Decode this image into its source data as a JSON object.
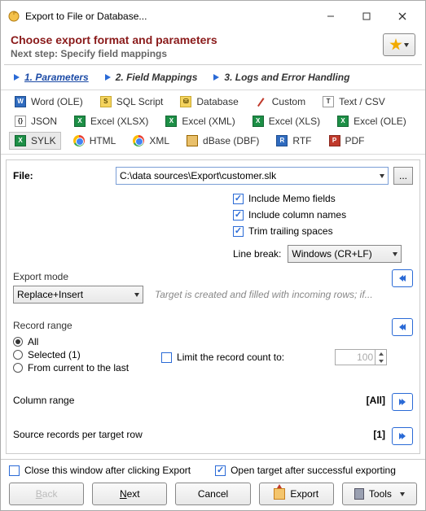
{
  "window": {
    "title": "Export to File or Database..."
  },
  "header": {
    "title": "Choose export format and parameters",
    "subtitle": "Next step: Specify field mappings"
  },
  "steps": {
    "s1": "1. Parameters",
    "s2": "2. Field Mappings",
    "s3": "3. Logs and Error Handling"
  },
  "formats": {
    "word_ole": "Word (OLE)",
    "sql_script": "SQL Script",
    "database": "Database",
    "custom": "Custom",
    "text_csv": "Text / CSV",
    "json": "JSON",
    "excel_xlsx": "Excel (XLSX)",
    "excel_xml": "Excel (XML)",
    "excel_xls": "Excel (XLS)",
    "excel_ole": "Excel (OLE)",
    "sylk": "SYLK",
    "html": "HTML",
    "xml": "XML",
    "dbase_dbf": "dBase (DBF)",
    "rtf": "RTF",
    "pdf": "PDF"
  },
  "file": {
    "label": "File:",
    "path": "C:\\data sources\\Export\\customer.slk"
  },
  "options": {
    "include_memo": "Include Memo fields",
    "include_cols": "Include column names",
    "trim_spaces": "Trim trailing spaces"
  },
  "linebreak": {
    "label": "Line break:",
    "value": "Windows (CR+LF)"
  },
  "export_mode": {
    "label": "Export mode",
    "value": "Replace+Insert",
    "hint": "Target is created and filled with incoming rows; if..."
  },
  "record_range": {
    "label": "Record range",
    "all": "All",
    "selected": "Selected (1)",
    "from_current": "From current to the last",
    "limit_label": "Limit the record count to:",
    "limit_value": "100"
  },
  "column_range": {
    "label": "Column range",
    "value": "[All]"
  },
  "src_per_row": {
    "label": "Source records per target row",
    "value": "[1]"
  },
  "footer": {
    "close_after": "Close this window after clicking Export",
    "open_target": "Open target after successful exporting",
    "back": "Back",
    "next": "Next",
    "cancel": "Cancel",
    "export": "Export",
    "tools": "Tools"
  },
  "glyph": {
    "ellipsis": "..."
  }
}
